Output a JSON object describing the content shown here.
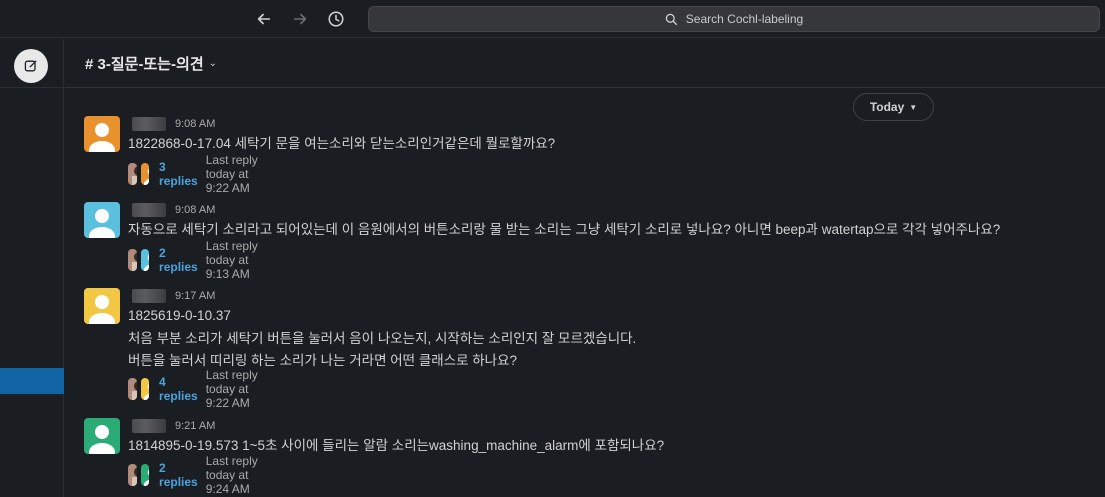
{
  "search": {
    "placeholder": "Search Cochl-labeling"
  },
  "channel": {
    "name": "# 3-질문-또는-의견"
  },
  "day_divider": {
    "label": "Today"
  },
  "colors": {
    "accent_blue": "#1164a3",
    "link": "#4aa3df"
  },
  "messages": [
    {
      "time": "9:08 AM",
      "lines": [
        "1822868-0-17.04 세탁기 문을 여는소리와 닫는소리인거같은데 뭘로할까요?"
      ],
      "replies": "3 replies",
      "last_reply": "Last reply today at 9:22 AM",
      "avatar_color": "#e8912d"
    },
    {
      "time": "9:08 AM",
      "lines": [
        "자동으로 세탁기 소리라고 되어있는데 이 음원에서의 버튼소리랑 물 받는 소리는 그냥 세탁기 소리로 넣나요? 아니면 beep과 watertap으로 각각 넣어주나요?"
      ],
      "replies": "2 replies",
      "last_reply": "Last reply today at 9:13 AM",
      "avatar_color": "#5bc0de"
    },
    {
      "time": "9:17 AM",
      "lines": [
        "1825619-0-10.37",
        "처음 부분 소리가 세탁기 버튼을 눌러서 음이 나오는지, 시작하는 소리인지 잘 모르겠습니다.",
        "버튼을 눌러서 띠리링 하는 소리가 나는 거라면 어떤 클래스로 하나요?"
      ],
      "replies": "4 replies",
      "last_reply": "Last reply today at 9:22 AM",
      "avatar_color": "#f2c744"
    },
    {
      "time": "9:21 AM",
      "lines": [
        "1814895-0-19.573 1~5초 사이에 들리는 알람 소리는washing_machine_alarm에 포함되나요?"
      ],
      "replies": "2 replies",
      "last_reply": "Last reply today at 9:24 AM",
      "avatar_color": "#2bac76"
    }
  ]
}
